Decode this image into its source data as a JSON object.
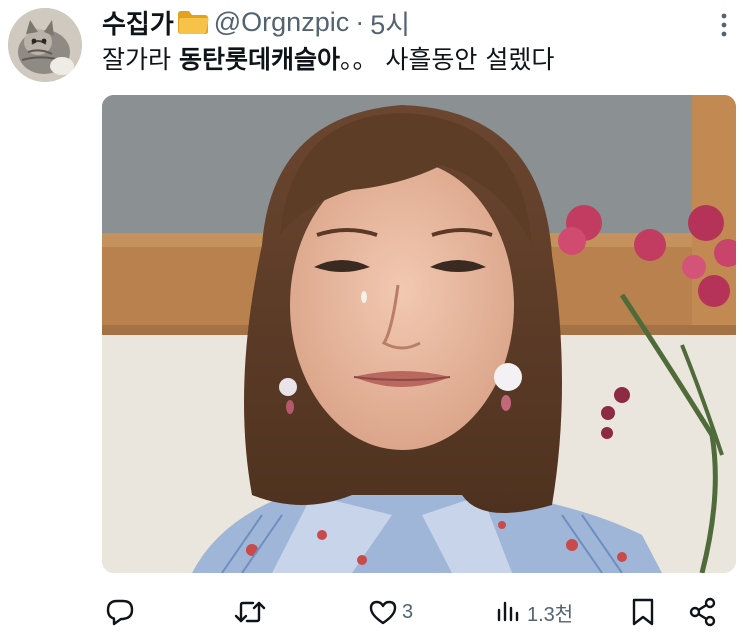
{
  "author": {
    "display_name": "수집가",
    "handle": "@Orgnzpic",
    "separator": "·",
    "time": "5시"
  },
  "tweet": {
    "text_plain_1": "잘가라 ",
    "text_bold": "동탄롯데캐슬아",
    "text_plain_2": "。。 사흘동안 설렜다"
  },
  "icons": {
    "avatar": "cat-avatar",
    "folder": "folder-emoji-icon",
    "more": "more-vertical-icon",
    "reply": "reply-icon",
    "retweet": "retweet-icon",
    "like": "heart-icon",
    "views": "views-chart-icon",
    "bookmark": "bookmark-icon",
    "share": "share-icon"
  },
  "actions": {
    "likes_count": "3",
    "views_count": "1.3천"
  },
  "colors": {
    "text_primary": "#0f1419",
    "text_secondary": "#536471",
    "folder": "#f2b632"
  }
}
